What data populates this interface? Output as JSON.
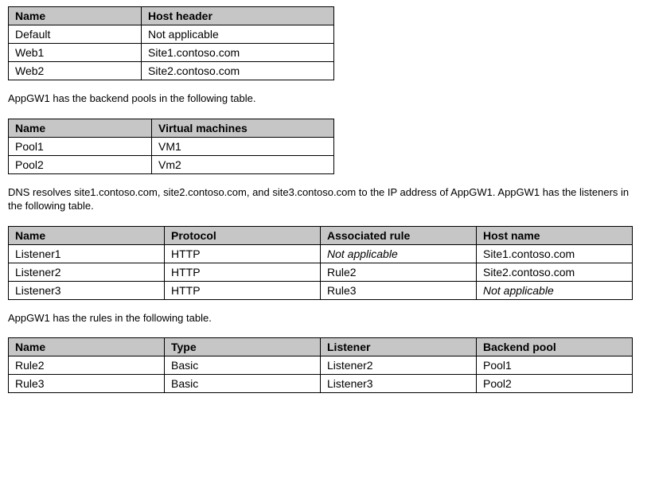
{
  "table1": {
    "headers": [
      "Name",
      "Host header"
    ],
    "rows": [
      [
        "Default",
        "Not applicable"
      ],
      [
        "Web1",
        "Site1.contoso.com"
      ],
      [
        "Web2",
        "Site2.contoso.com"
      ]
    ]
  },
  "para1": "AppGW1 has the backend pools in the following table.",
  "table2": {
    "headers": [
      "Name",
      "Virtual machines"
    ],
    "rows": [
      [
        "Pool1",
        "VM1"
      ],
      [
        "Pool2",
        "Vm2"
      ]
    ]
  },
  "para2": "DNS resolves site1.contoso.com, site2.contoso.com, and site3.contoso.com to the IP address of AppGW1. AppGW1 has the listeners in the following table.",
  "table3": {
    "headers": [
      "Name",
      "Protocol",
      "Associated rule",
      "Host name"
    ],
    "rows": [
      {
        "c0": "Listener1",
        "c1": "HTTP",
        "c2": "Not applicable",
        "c2_italic": true,
        "c3": "Site1.contoso.com"
      },
      {
        "c0": "Listener2",
        "c1": "HTTP",
        "c2": "Rule2",
        "c2_italic": false,
        "c3": "Site2.contoso.com"
      },
      {
        "c0": "Listener3",
        "c1": "HTTP",
        "c2": "Rule3",
        "c2_italic": false,
        "c3": "Not applicable",
        "c3_italic": true
      }
    ]
  },
  "para3": "AppGW1 has the rules in the following table.",
  "table4": {
    "headers": [
      "Name",
      "Type",
      "Listener",
      "Backend pool"
    ],
    "rows": [
      [
        "Rule2",
        "Basic",
        "Listener2",
        "Pool1"
      ],
      [
        "Rule3",
        "Basic",
        "Listener3",
        "Pool2"
      ]
    ]
  }
}
